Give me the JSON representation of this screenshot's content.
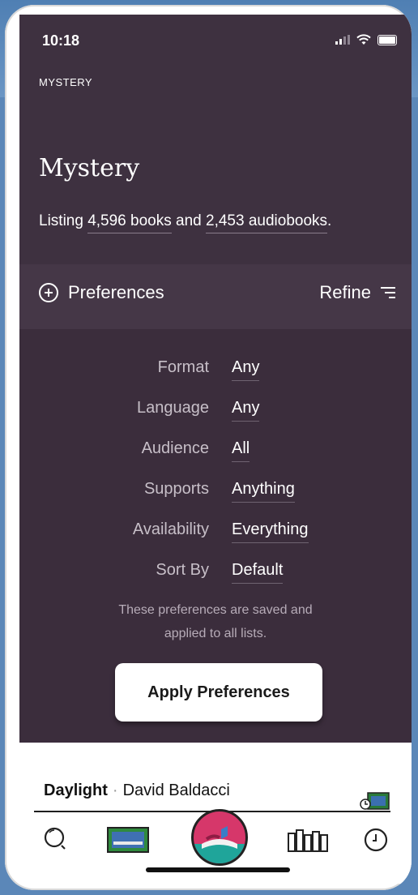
{
  "status_bar": {
    "time": "10:18"
  },
  "breadcrumb": "MYSTERY",
  "header": {
    "title": "Mystery",
    "listing_prefix": "Listing",
    "books_count": "4,596 books",
    "and": "and",
    "audiobooks_count": "2,453 audiobooks",
    "period": "."
  },
  "bar": {
    "preferences_label": "Preferences",
    "refine_label": "Refine"
  },
  "preferences": [
    {
      "label": "Format",
      "value": "Any"
    },
    {
      "label": "Language",
      "value": "Any"
    },
    {
      "label": "Audience",
      "value": "All"
    },
    {
      "label": "Supports",
      "value": "Anything"
    },
    {
      "label": "Availability",
      "value": "Everything"
    },
    {
      "label": "Sort By",
      "value": "Default"
    }
  ],
  "note_line1": "These preferences are saved and",
  "note_line2": "applied to all lists.",
  "apply_button": "Apply Preferences",
  "now_playing": {
    "title": "Daylight",
    "separator": "·",
    "author": "David Baldacci"
  },
  "tab_bar": [
    "search-icon",
    "library-card-icon",
    "libby-home-icon",
    "shelf-icon",
    "timeline-icon"
  ],
  "colors": {
    "dark_bg": "#3e3140",
    "panel_bg": "#3b2d3c",
    "accent": "#d6376a"
  }
}
